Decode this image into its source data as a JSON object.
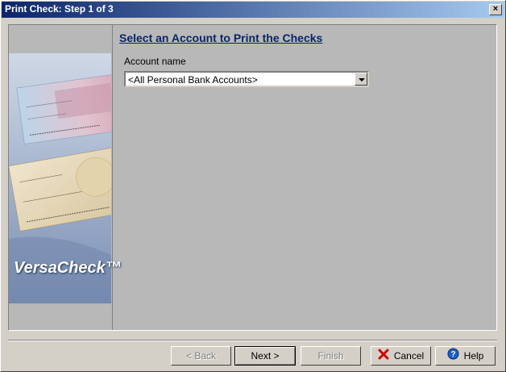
{
  "window": {
    "title": "Print Check: Step 1 of 3",
    "close_glyph": "×"
  },
  "sidebar": {
    "brand": "VersaCheck™"
  },
  "main": {
    "heading": "Select an Account to Print the Checks",
    "account_label": "Account name",
    "account_value": "<All Personal Bank Accounts>"
  },
  "footer": {
    "back": "< Back",
    "next": "Next >",
    "finish": "Finish",
    "cancel": "Cancel",
    "help": "Help"
  },
  "colors": {
    "title_bar": "#0a246a",
    "heading": "#0a246a",
    "cancel_icon": "#d00000",
    "help_icon": "#1a5fc8"
  }
}
